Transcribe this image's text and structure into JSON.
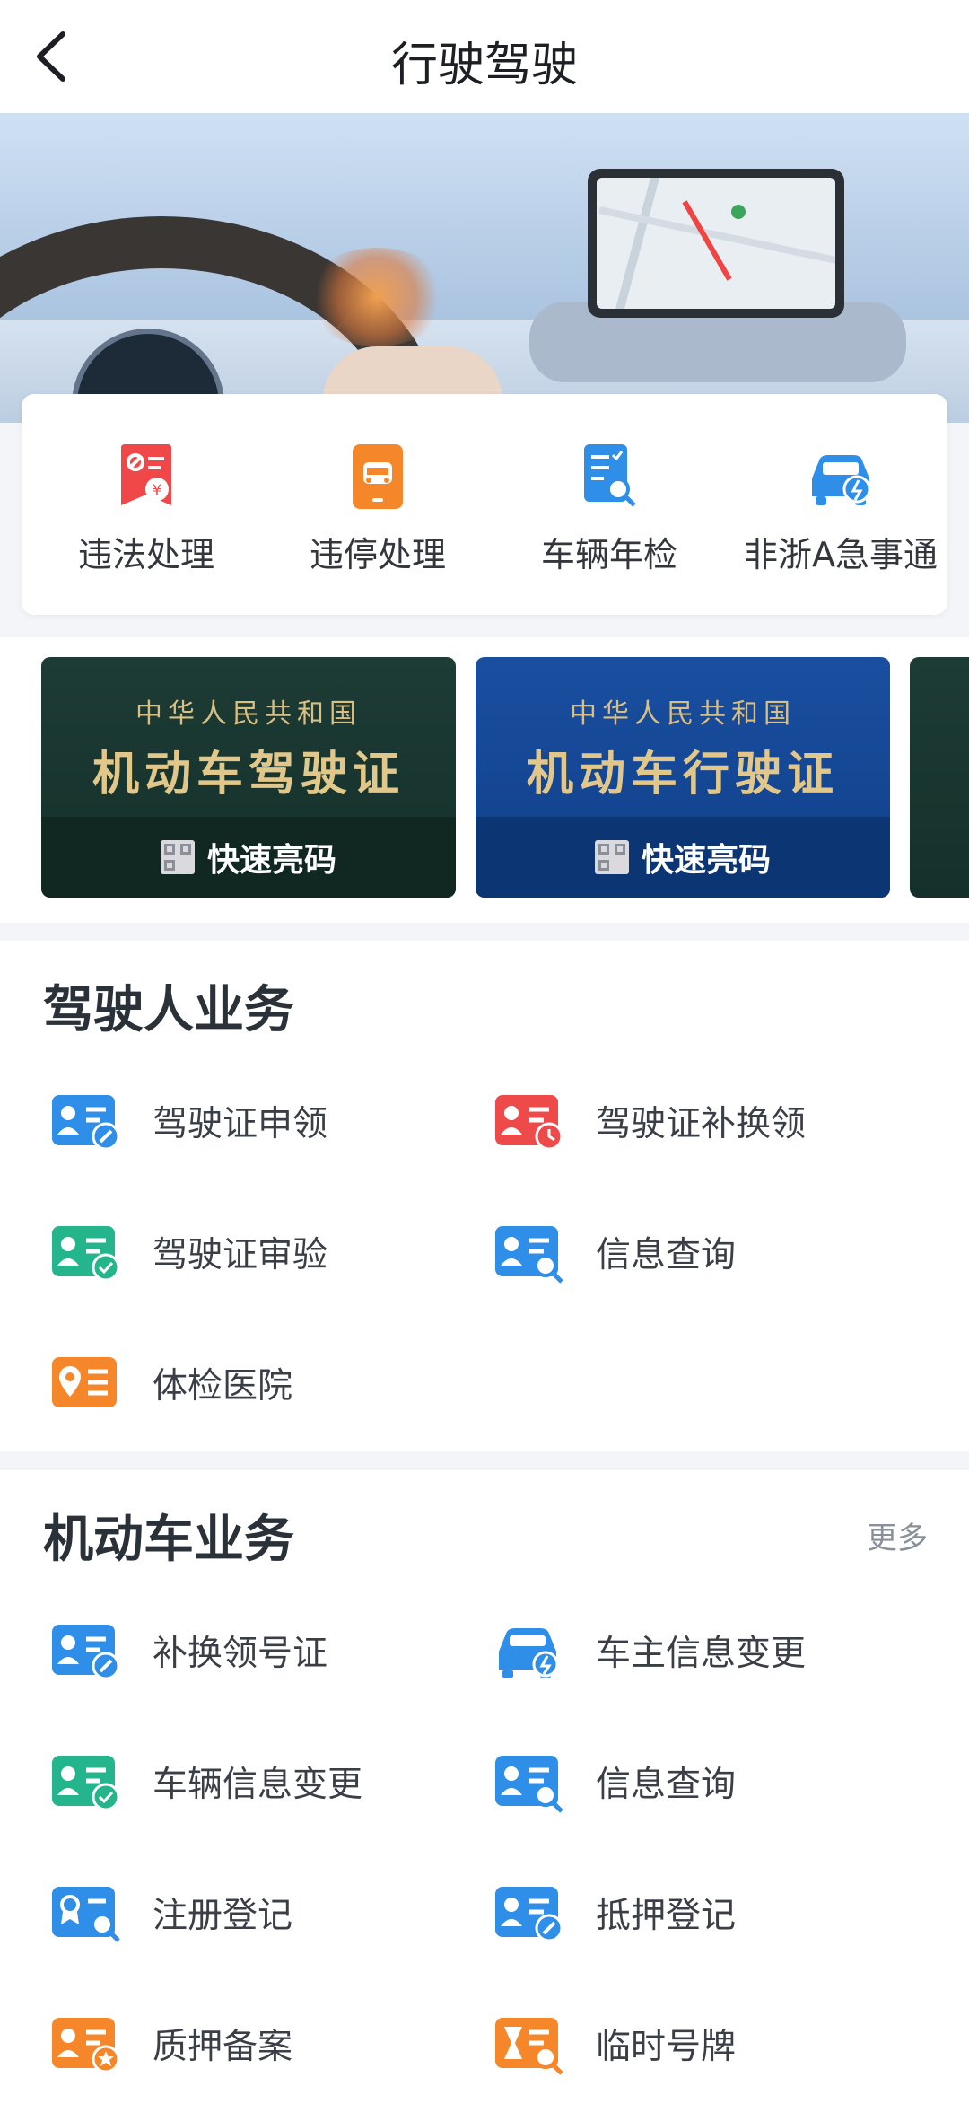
{
  "header": {
    "title": "行驶驾驶"
  },
  "quick_actions": [
    {
      "label": "违法处理",
      "icon": "violation-ticket-icon",
      "color": "#f04848"
    },
    {
      "label": "违停处理",
      "icon": "parking-violation-icon",
      "color": "#f5872a"
    },
    {
      "label": "车辆年检",
      "icon": "inspection-icon",
      "color": "#2f8ee8"
    },
    {
      "label": "非浙A急事通",
      "icon": "car-urgent-icon",
      "color": "#2f8ee8"
    }
  ],
  "license_cards": [
    {
      "line1": "中华人民共和国",
      "line2": "机动车驾驶证",
      "button": "快速亮码",
      "color": "#1d3c35"
    },
    {
      "line1": "中华人民共和国",
      "line2": "机动车行驶证",
      "button": "快速亮码",
      "color": "#1a4fa0"
    }
  ],
  "driver_section": {
    "title": "驾驶人业务",
    "items": [
      {
        "label": "驾驶证申领",
        "icon": "license-apply-icon",
        "color": "#2f8ee8"
      },
      {
        "label": "驾驶证补换领",
        "icon": "license-renew-icon",
        "color": "#ef4a4a"
      },
      {
        "label": "驾驶证审验",
        "icon": "license-verify-icon",
        "color": "#25b58c"
      },
      {
        "label": "信息查询",
        "icon": "info-search-icon",
        "color": "#2f8ee8"
      },
      {
        "label": "体检医院",
        "icon": "hospital-location-icon",
        "color": "#f5872a"
      }
    ]
  },
  "vehicle_section": {
    "title": "机动车业务",
    "more": "更多",
    "items": [
      {
        "label": "补换领号证",
        "icon": "plate-renew-icon",
        "color": "#2f8ee8"
      },
      {
        "label": "车主信息变更",
        "icon": "owner-change-icon",
        "color": "#2f8ee8"
      },
      {
        "label": "车辆信息变更",
        "icon": "vehicle-change-icon",
        "color": "#25b58c"
      },
      {
        "label": "信息查询",
        "icon": "info-search-icon",
        "color": "#2f8ee8"
      },
      {
        "label": "注册登记",
        "icon": "register-icon",
        "color": "#2f8ee8"
      },
      {
        "label": "抵押登记",
        "icon": "mortgage-icon",
        "color": "#2f8ee8"
      },
      {
        "label": "质押备案",
        "icon": "pledge-icon",
        "color": "#f5872a"
      },
      {
        "label": "临时号牌",
        "icon": "temp-plate-icon",
        "color": "#f5872a"
      }
    ]
  }
}
